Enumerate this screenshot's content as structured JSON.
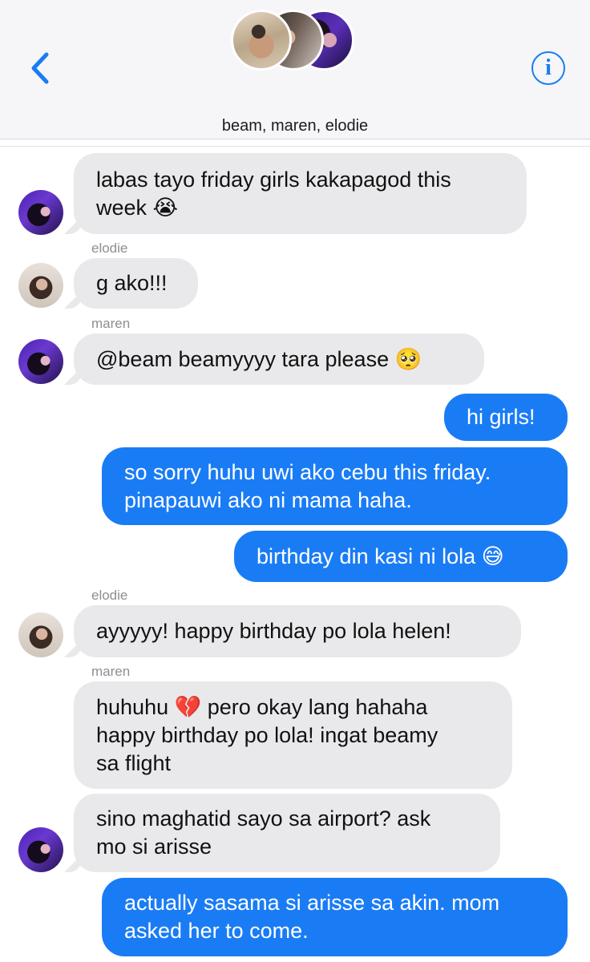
{
  "header": {
    "group_name": "beam, maren, elodie",
    "back_icon": "chevron-left-icon",
    "info_icon": "info-icon",
    "info_glyph": "i",
    "accent_color": "#1a7cf5"
  },
  "messages": [
    {
      "sender": "",
      "direction": "incoming",
      "lines": [
        "labas tayo friday girls kakapagod this",
        "week 😭"
      ]
    },
    {
      "sender": "elodie",
      "direction": "incoming",
      "lines": [
        "g ako!!!"
      ]
    },
    {
      "sender": "maren",
      "direction": "incoming",
      "lines": [
        "@beam beamyyyy tara please 🥺"
      ]
    },
    {
      "sender": "",
      "direction": "outgoing",
      "lines": [
        "hi girls!"
      ]
    },
    {
      "sender": "",
      "direction": "outgoing",
      "lines": [
        "so sorry huhu uwi ako cebu this friday.",
        "pinapauwi ako ni mama haha."
      ]
    },
    {
      "sender": "",
      "direction": "outgoing",
      "lines": [
        "birthday din kasi ni lola 😅"
      ]
    },
    {
      "sender": "elodie",
      "direction": "incoming",
      "lines": [
        "ayyyyy! happy birthday po lola helen!"
      ]
    },
    {
      "sender": "maren",
      "direction": "incoming",
      "lines": [
        "huhuhu 💔 pero okay lang hahaha",
        "happy birthday po lola! ingat beamy",
        "sa flight"
      ]
    },
    {
      "sender": "",
      "direction": "incoming",
      "lines": [
        "sino maghatid sayo sa airport? ask",
        "mo si arisse"
      ]
    },
    {
      "sender": "",
      "direction": "outgoing",
      "lines": [
        "actually sasama si arisse sa akin. mom",
        "asked her to come."
      ]
    }
  ]
}
